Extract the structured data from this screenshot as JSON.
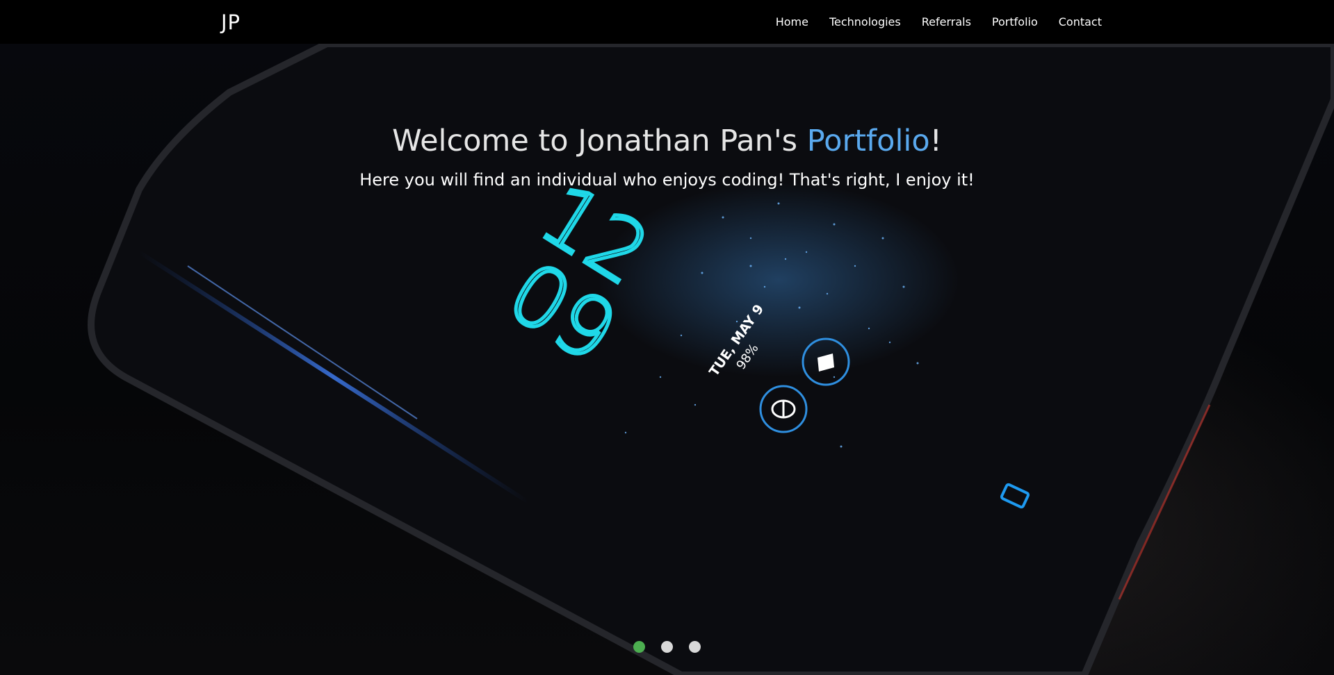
{
  "nav": {
    "brand": "JP",
    "links": [
      "Home",
      "Technologies",
      "Referrals",
      "Portfolio",
      "Contact"
    ]
  },
  "hero": {
    "title_prefix": "Welcome to Jonathan Pan's ",
    "title_accent": "Portfolio",
    "title_suffix": "!",
    "subtitle": "Here you will find an individual who enjoys coding! That's right, I enjoy it!",
    "phone_screen": {
      "hour": "12",
      "minute": "09",
      "date": "TUE, MAY 9",
      "battery": "98%"
    }
  },
  "carousel": {
    "slide_count": 3,
    "active_index": 0
  },
  "colors": {
    "accent": "#5aa9ee",
    "active_indicator": "#4caf50",
    "clock": "#1fd8e8"
  }
}
